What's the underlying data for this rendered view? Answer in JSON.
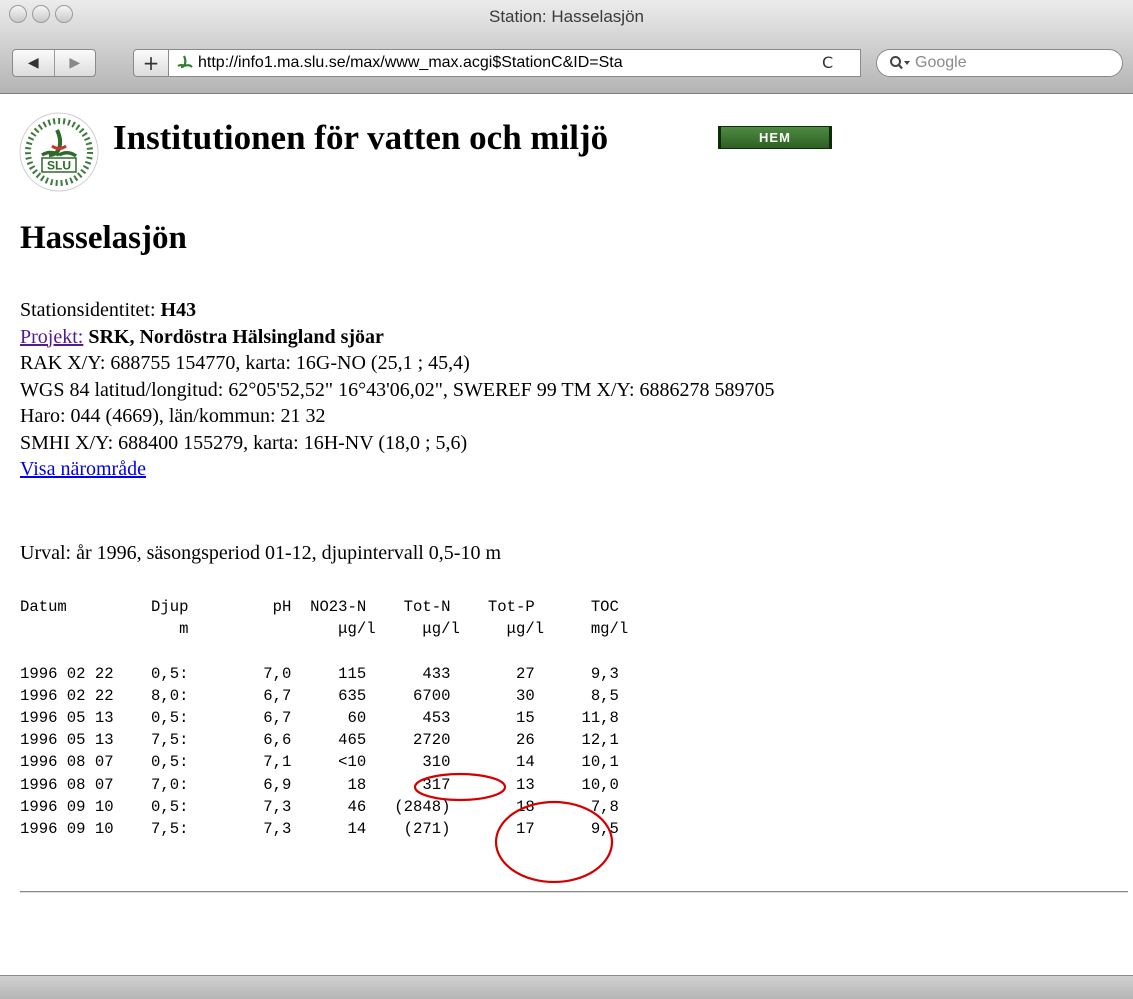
{
  "window": {
    "title": "Station: Hasselasjön"
  },
  "toolbar": {
    "back_label": "◀",
    "forward_label": "▶",
    "add_label": "+",
    "url": "http://info1.ma.slu.se/max/www_max.acgi$StationC&ID=Sta",
    "reload_label": "C",
    "search_placeholder": "Google"
  },
  "header": {
    "logo_text": "SLU",
    "title": "Institutionen för vatten och miljö",
    "home_button": "HEM"
  },
  "station": {
    "name": "Hasselasjön",
    "id_label": "Stationsidentitet:",
    "id_value": "H43",
    "project_link": "Projekt:",
    "project_value": "SRK, Nordöstra Hälsingland sjöar",
    "rak": "RAK X/Y: 688755 154770, karta: 16G-NO (25,1 ; 45,4)",
    "wgs": "WGS 84 latitud/longitud: 62°05'52,52\" 16°43'06,02\", SWEREF 99 TM X/Y: 6886278 589705",
    "haro": "Haro: 044 (4669), län/kommun: 21 32",
    "smhi": "SMHI X/Y: 688400 155279, karta: 16H-NV (18,0 ; 5,6)",
    "nearby_link": "Visa närområde"
  },
  "selection": "Urval: år 1996, säsongsperiod 01-12, djupintervall 0,5-10 m",
  "table": {
    "header_line1": "Datum         Djup         pH  NO23-N    Tot-N    Tot-P      TOC",
    "header_line2": "                 m                μg/l     μg/l     μg/l     mg/l",
    "rows": [
      "1996 02 22    0,5:        7,0     115      433       27      9,3",
      "1996 02 22    8,0:        6,7     635     6700       30      8,5",
      "1996 05 13    0,5:        6,7      60      453       15     11,8",
      "1996 05 13    7,5:        6,6     465     2720       26     12,1",
      "1996 08 07    0,5:        7,1     <10      310       14     10,1",
      "1996 08 07    7,0:        6,9      18      317       13     10,0",
      "1996 09 10    0,5:        7,3      46   (2848)       18      7,8",
      "1996 09 10    7,5:        7,3      14    (271)       17      9,5"
    ]
  },
  "colors": {
    "annotation": "#d40000",
    "link": "#0000ee",
    "visited_link": "#551a8b",
    "home_button": "#3a7530"
  }
}
